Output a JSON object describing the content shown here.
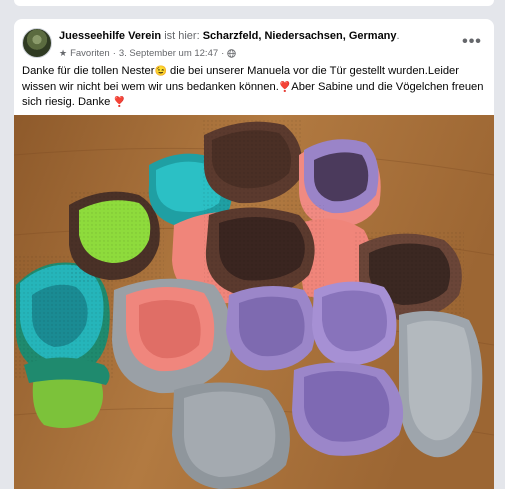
{
  "post": {
    "author": "Juesseehilfe Verein",
    "location_prefix": "ist hier:",
    "location": "Scharzfeld, Niedersachsen, Germany",
    "location_suffix": ".",
    "audience": "Favoriten",
    "separator": "·",
    "timestamp": "3. September um 12:47",
    "timestamp_separator": "·",
    "text_part1": "Danke für die tollen Nester",
    "emoji1": "😉",
    "text_part2": " die bei unserer Manuela vor die Tür gestellt wurden.Leider wissen wir nicht bei wem wir uns bedanken können.",
    "emoji2": "❣️",
    "text_part3": "Aber Sabine und die Vögelchen freuen sich riesig. Danke ",
    "emoji3": "❣️",
    "more_label": "•••"
  },
  "photo": {
    "description_colors": {
      "table": "#a06a34",
      "brown": "#5a3a2c",
      "teal": "#1fb3b8",
      "salmon": "#ee7d73",
      "lavender": "#9b86c9",
      "grey": "#9da3a9",
      "lime": "#8edb3c"
    }
  }
}
